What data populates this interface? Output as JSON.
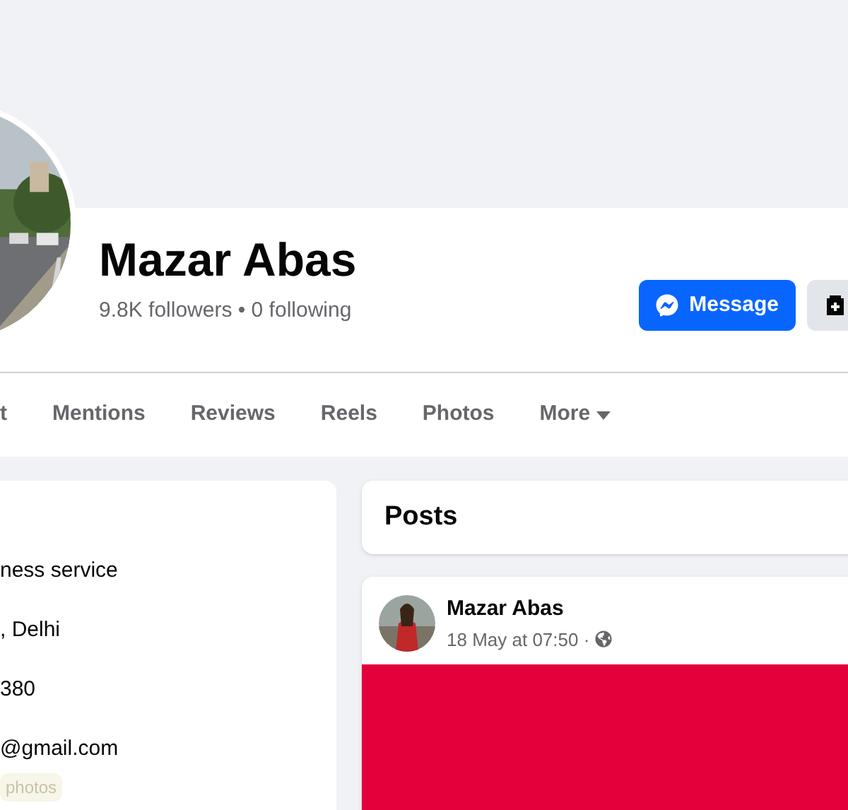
{
  "profile": {
    "name": "Mazar Abas",
    "stats": "9.8K followers • 0 following"
  },
  "actions": [
    {
      "kind": "primary",
      "label": "Message"
    },
    {
      "kind": "icon"
    }
  ],
  "tabs": [
    {
      "label": "t",
      "selected": false,
      "dropdown": false
    },
    {
      "label": "Mentions",
      "selected": false,
      "dropdown": false
    },
    {
      "label": "Reviews",
      "selected": false,
      "dropdown": false
    },
    {
      "label": "Reels",
      "selected": false,
      "dropdown": false
    },
    {
      "label": "Photos",
      "selected": false,
      "dropdown": false
    },
    {
      "label": "More",
      "selected": false,
      "dropdown": true
    }
  ],
  "intro": {
    "items": [
      "ness service",
      ", Delhi",
      "380",
      "@gmail.com"
    ],
    "badge": "photos"
  },
  "posts": {
    "title": "Posts",
    "post": {
      "author": "Mazar Abas",
      "time": "18 May at 07:50 ·"
    }
  }
}
